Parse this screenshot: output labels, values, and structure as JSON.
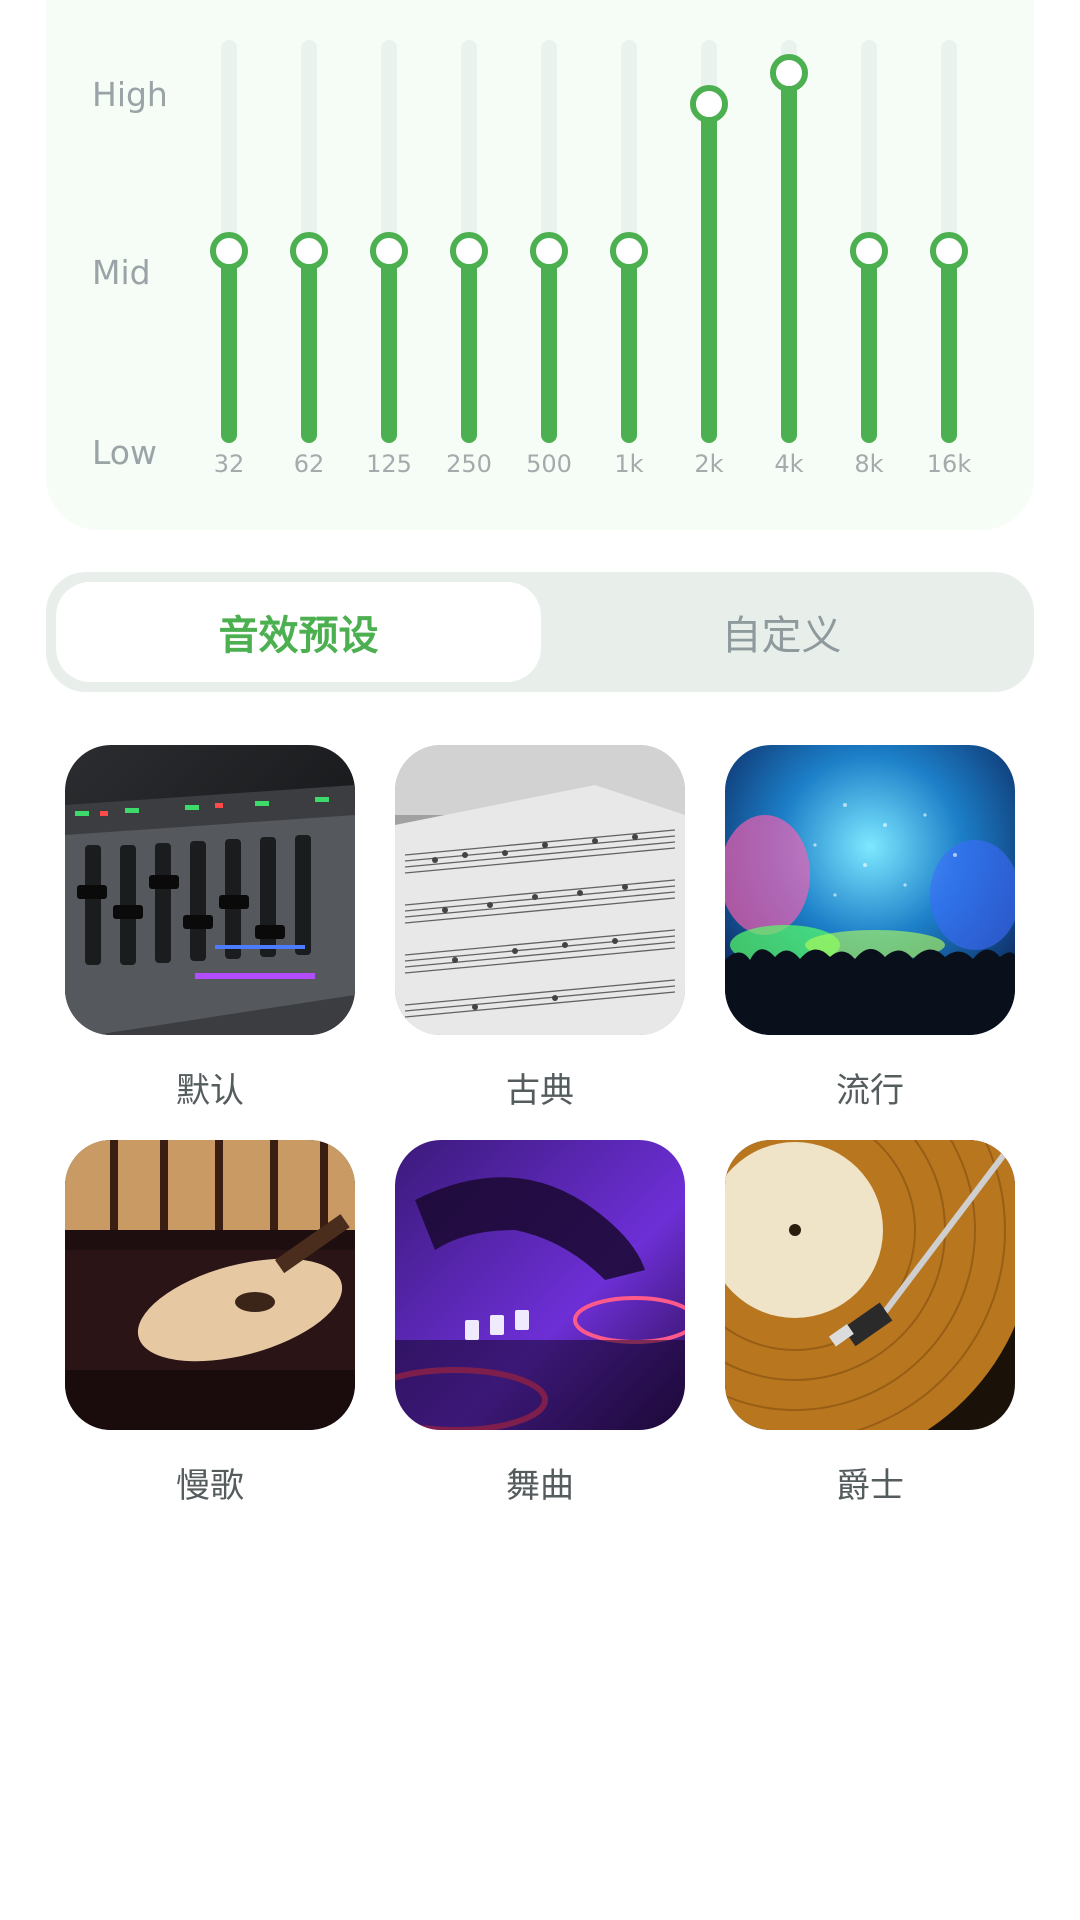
{
  "equalizer": {
    "level_labels": {
      "high": "High",
      "mid": "Mid",
      "low": "Low"
    },
    "bands": [
      {
        "freq": "32",
        "level": 0.5
      },
      {
        "freq": "62",
        "level": 0.5
      },
      {
        "freq": "125",
        "level": 0.5
      },
      {
        "freq": "250",
        "level": 0.5
      },
      {
        "freq": "500",
        "level": 0.5
      },
      {
        "freq": "1k",
        "level": 0.5
      },
      {
        "freq": "2k",
        "level": 0.88
      },
      {
        "freq": "4k",
        "level": 0.96
      },
      {
        "freq": "8k",
        "level": 0.5
      },
      {
        "freq": "16k",
        "level": 0.5
      }
    ],
    "accent_color": "#4caf50",
    "track_color": "#e9f2ed"
  },
  "tabs": {
    "presets_label": "音效预设",
    "custom_label": "自定义",
    "active": "presets"
  },
  "presets": [
    {
      "label": "默认",
      "image": "mixing-console-photo"
    },
    {
      "label": "古典",
      "image": "sheet-music-photo"
    },
    {
      "label": "流行",
      "image": "concert-crowd-photo"
    },
    {
      "label": "慢歌",
      "image": "acoustic-guitar-photo"
    },
    {
      "label": "舞曲",
      "image": "dj-turntable-photo"
    },
    {
      "label": "爵士",
      "image": "vinyl-record-photo"
    }
  ]
}
